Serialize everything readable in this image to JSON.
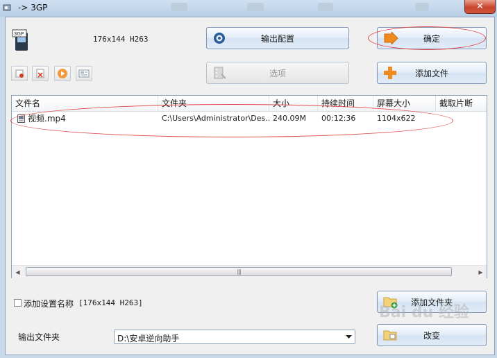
{
  "window": {
    "title": "-> 3GP",
    "close_label": "✕"
  },
  "format": {
    "icon_text": "3GP",
    "description": "176x144 H263"
  },
  "buttons": {
    "output_config": "输出配置",
    "ok": "确定",
    "options": "选项",
    "add_file": "添加文件",
    "add_folder": "添加文件夹",
    "change": "改变"
  },
  "toolbar": {
    "items": [
      "remove-item",
      "clear-list",
      "play",
      "info"
    ]
  },
  "file_list": {
    "columns": [
      "文件名",
      "文件夹",
      "大小",
      "持续时间",
      "屏幕大小",
      "截取片断"
    ],
    "rows": [
      {
        "name": "视频.mp4",
        "folder": "C:\\Users\\Administrator\\Des...",
        "size": "240.09M",
        "duration": "00:12:36",
        "screen_size": "1104x622",
        "clip": ""
      }
    ]
  },
  "add_setting_name": {
    "label": "添加设置名称",
    "value": "[176x144 H263]",
    "checked": false
  },
  "output_folder": {
    "label": "输出文件夹",
    "value": "D:\\安卓逆向助手"
  },
  "watermark": "Bai du 经验",
  "colors": {
    "annotation": "#e04848",
    "accent_orange": "#f08a1c"
  }
}
